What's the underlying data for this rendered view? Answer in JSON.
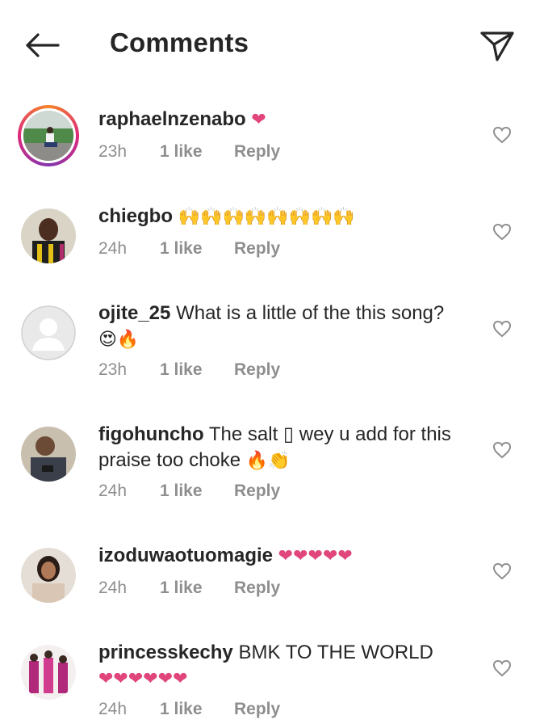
{
  "header": {
    "title": "Comments"
  },
  "comments": [
    {
      "username": "raphaelnzenabo",
      "text": "",
      "emoji": "❤",
      "time": "23h",
      "likes": "1 like",
      "reply": "Reply"
    },
    {
      "username": "chiegbo",
      "text": "",
      "emoji": "🙌🙌🙌🙌🙌🙌🙌🙌",
      "time": "24h",
      "likes": "1 like",
      "reply": "Reply"
    },
    {
      "username": "ojite_25",
      "text": "What is a little of the this song?",
      "emoji": "😍🔥",
      "time": "23h",
      "likes": "1 like",
      "reply": "Reply"
    },
    {
      "username": "figohuncho",
      "text": "The salt ▯ wey u add for this praise too choke",
      "emoji": "🔥👏",
      "time": "24h",
      "likes": "1 like",
      "reply": "Reply"
    },
    {
      "username": "izoduwaotuomagie",
      "text": "",
      "emoji": "❤❤❤❤❤",
      "time": "24h",
      "likes": "1 like",
      "reply": "Reply"
    },
    {
      "username": "princesskechy",
      "text": "BMK TO THE WORLD",
      "emoji": "❤❤❤❤❤❤",
      "time": "24h",
      "likes": "1 like",
      "reply": "Reply"
    }
  ],
  "colors": {
    "heart": "#e0457b",
    "meta": "#8e8e8e",
    "text": "#262626"
  },
  "icons": {
    "back": "arrow-left-icon",
    "send": "paper-plane-icon",
    "like": "heart-outline-icon"
  }
}
